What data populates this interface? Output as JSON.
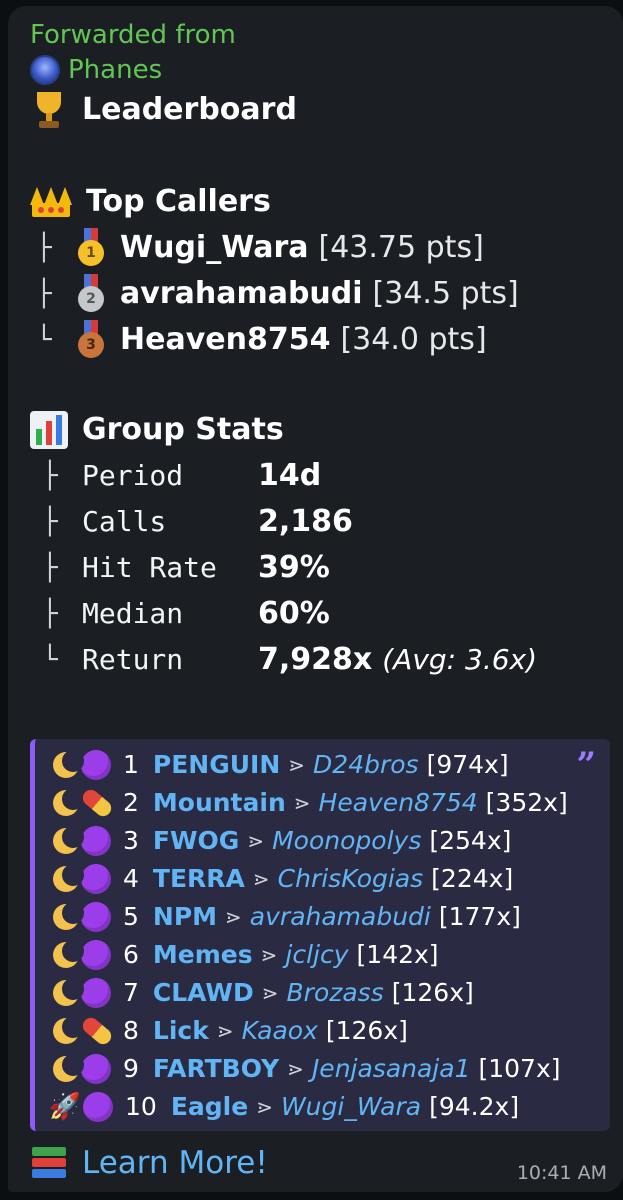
{
  "forward": {
    "label": "Forwarded from",
    "source": "Phanes"
  },
  "title": "Leaderboard",
  "top_callers": {
    "heading": "Top Callers",
    "items": [
      {
        "branch": "├",
        "medal": "1",
        "name": "Wugi_Wara",
        "pts": "[43.75 pts]"
      },
      {
        "branch": "├",
        "medal": "2",
        "name": "avrahamabudi",
        "pts": "[34.5 pts]"
      },
      {
        "branch": "└",
        "medal": "3",
        "name": "Heaven8754",
        "pts": "[34.0 pts]"
      }
    ]
  },
  "group_stats": {
    "heading": "Group Stats",
    "items": [
      {
        "branch": "├",
        "label": "Period",
        "value": "14d",
        "extra": ""
      },
      {
        "branch": "├",
        "label": "Calls",
        "value": "2,186",
        "extra": ""
      },
      {
        "branch": "├",
        "label": "Hit Rate",
        "value": "39%",
        "extra": ""
      },
      {
        "branch": "├",
        "label": "Median",
        "value": "60%",
        "extra": ""
      },
      {
        "branch": "└",
        "label": "Return",
        "value": "7,928x",
        "extra": "(Avg: 3.6x)"
      }
    ]
  },
  "leaderboard": [
    {
      "icon1": "moon",
      "icon2": "purple-circle",
      "rank": "1",
      "token": "PENGUIN",
      "arrow": "⋗",
      "caller": "D24bros",
      "mult": "[974x]"
    },
    {
      "icon1": "moon",
      "icon2": "pill",
      "rank": "2",
      "token": "Mountain",
      "arrow": "⋗",
      "caller": "Heaven8754",
      "mult": "[352x]"
    },
    {
      "icon1": "moon",
      "icon2": "purple-circle",
      "rank": "3",
      "token": "FWOG",
      "arrow": "⋗",
      "caller": "Moonopolys",
      "mult": "[254x]"
    },
    {
      "icon1": "moon",
      "icon2": "purple-circle",
      "rank": "4",
      "token": "TERRA",
      "arrow": "⋗",
      "caller": "ChrisKogias",
      "mult": "[224x]"
    },
    {
      "icon1": "moon",
      "icon2": "purple-circle",
      "rank": "5",
      "token": "NPM",
      "arrow": "⋗",
      "caller": "avrahamabudi",
      "mult": "[177x]"
    },
    {
      "icon1": "moon",
      "icon2": "purple-circle",
      "rank": "6",
      "token": "Memes",
      "arrow": "⋗",
      "caller": "jcljcy",
      "mult": "[142x]"
    },
    {
      "icon1": "moon",
      "icon2": "purple-circle",
      "rank": "7",
      "token": "CLAWD",
      "arrow": "⋗",
      "caller": "Brozass",
      "mult": "[126x]"
    },
    {
      "icon1": "moon",
      "icon2": "pill",
      "rank": "8",
      "token": "Lick",
      "arrow": "⋗",
      "caller": "Kaaox",
      "mult": "[126x]"
    },
    {
      "icon1": "moon",
      "icon2": "purple-circle",
      "rank": "9",
      "token": "FARTBOY",
      "arrow": "⋗",
      "caller": "Jenjasanaja1",
      "mult": "[107x]"
    },
    {
      "icon1": "rocket",
      "icon2": "purple-circle",
      "rank": "10",
      "token": "Eagle",
      "arrow": "⋗",
      "caller": "Wugi_Wara",
      "mult": "[94.2x]"
    }
  ],
  "learn_more": "Learn More!",
  "timestamp": "10:41 AM",
  "colors": {
    "forward_green": "#62c554",
    "link_blue": "#62b5f5",
    "quote_accent": "#8b5cf6",
    "bubble_bg": "#1b1f24"
  }
}
